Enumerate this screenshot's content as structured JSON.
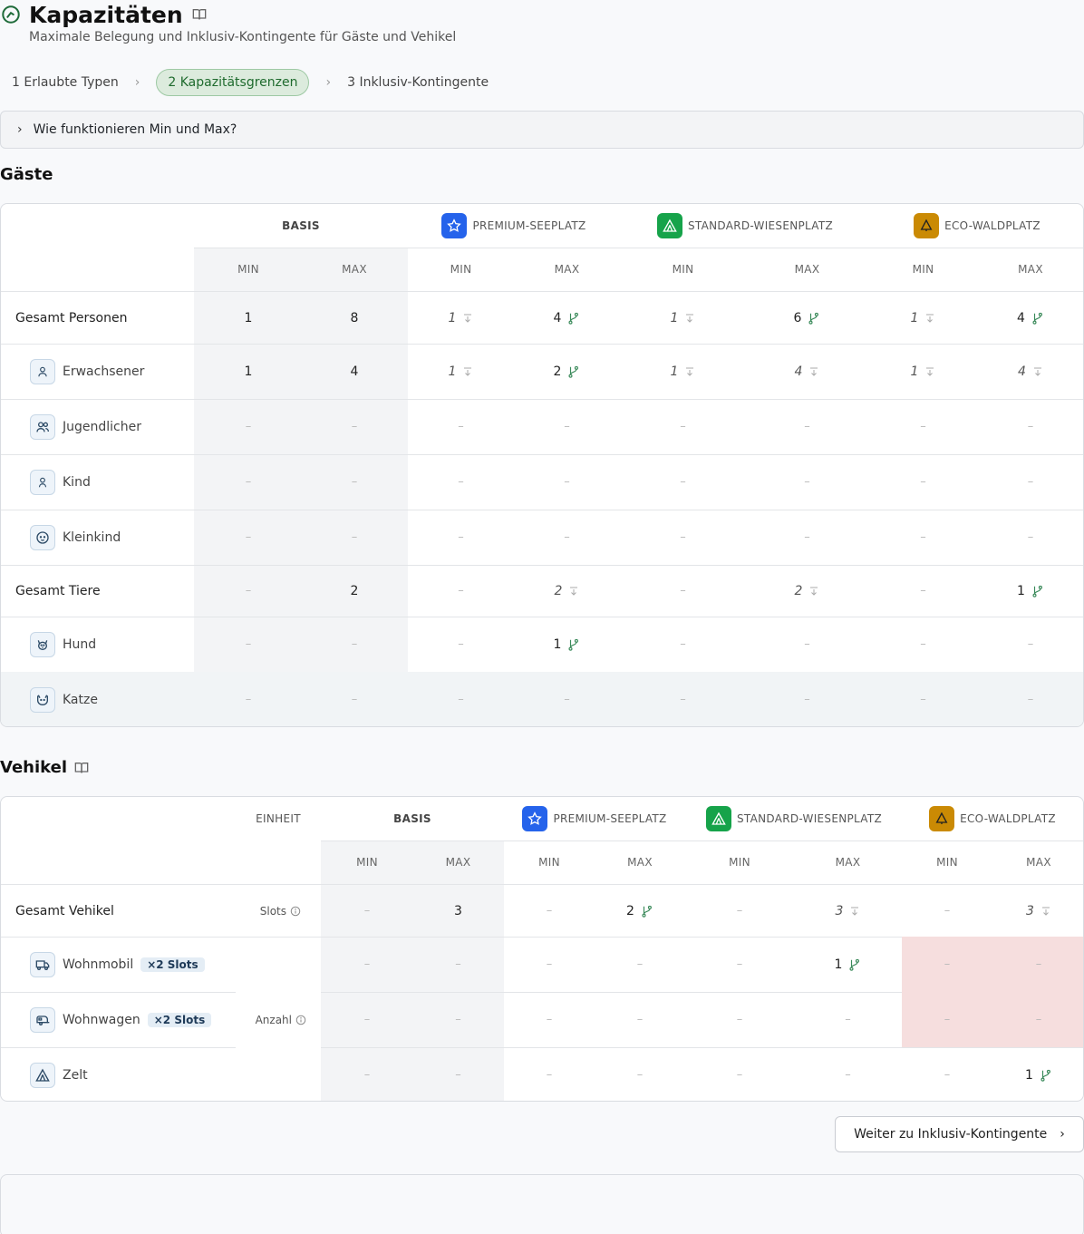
{
  "header": {
    "title": "Kapazitäten",
    "subtitle": "Maximale Belegung und Inklusiv-Kontingente für Gäste und Vehikel"
  },
  "steps": [
    {
      "label": "1  Erlaubte Typen",
      "active": false
    },
    {
      "label": "2  Kapazitätsgrenzen",
      "active": true
    },
    {
      "label": "3  Inklusiv-Kontingente",
      "active": false
    }
  ],
  "accordion": {
    "label": "Wie funktionieren Min und Max?"
  },
  "categories": {
    "basis": "BASIS",
    "premium": {
      "label": "PREMIUM-SEEPLATZ",
      "color": "#2563eb",
      "icon": "star-icon"
    },
    "standard": {
      "label": "STANDARD-WIESENPLATZ",
      "color": "#16a34a",
      "icon": "tent-icon"
    },
    "eco": {
      "label": "ECO-WALDPLATZ",
      "color": "#ca8a04",
      "icon": "tree-icon"
    }
  },
  "sub_headers": {
    "min": "MIN",
    "max": "MAX",
    "unit": "EINHEIT"
  },
  "guests": {
    "title": "Gäste",
    "rows": [
      {
        "label": "Gesamt Personen",
        "total": true,
        "icon": "",
        "cells": [
          [
            "1",
            ""
          ],
          [
            "8",
            ""
          ],
          [
            "1",
            "i"
          ],
          [
            "4",
            "b"
          ],
          [
            "1",
            "i"
          ],
          [
            "6",
            "b"
          ],
          [
            "1",
            "i"
          ],
          [
            "4",
            "b"
          ]
        ]
      },
      {
        "label": "Erwachsener",
        "total": false,
        "icon": "person-icon",
        "cells": [
          [
            "1",
            ""
          ],
          [
            "4",
            ""
          ],
          [
            "1",
            "i"
          ],
          [
            "2",
            "b"
          ],
          [
            "1",
            "i"
          ],
          [
            "4",
            "i"
          ],
          [
            "1",
            "i"
          ],
          [
            "4",
            "i"
          ]
        ]
      },
      {
        "label": "Jugendlicher",
        "total": false,
        "icon": "users-icon",
        "cells": [
          [
            "–",
            ""
          ],
          [
            "–",
            ""
          ],
          [
            "–",
            ""
          ],
          [
            "–",
            ""
          ],
          [
            "–",
            ""
          ],
          [
            "–",
            ""
          ],
          [
            "–",
            ""
          ],
          [
            "–",
            ""
          ]
        ]
      },
      {
        "label": "Kind",
        "total": false,
        "icon": "child-icon",
        "cells": [
          [
            "–",
            ""
          ],
          [
            "–",
            ""
          ],
          [
            "–",
            ""
          ],
          [
            "–",
            ""
          ],
          [
            "–",
            ""
          ],
          [
            "–",
            ""
          ],
          [
            "–",
            ""
          ],
          [
            "–",
            ""
          ]
        ]
      },
      {
        "label": "Kleinkind",
        "total": false,
        "icon": "baby-icon",
        "cells": [
          [
            "–",
            ""
          ],
          [
            "–",
            ""
          ],
          [
            "–",
            ""
          ],
          [
            "–",
            ""
          ],
          [
            "–",
            ""
          ],
          [
            "–",
            ""
          ],
          [
            "–",
            ""
          ],
          [
            "–",
            ""
          ]
        ]
      },
      {
        "label": "Gesamt Tiere",
        "total": true,
        "icon": "",
        "cells": [
          [
            "–",
            ""
          ],
          [
            "2",
            ""
          ],
          [
            "–",
            ""
          ],
          [
            "2",
            "i"
          ],
          [
            "–",
            ""
          ],
          [
            "2",
            "i"
          ],
          [
            "–",
            ""
          ],
          [
            "1",
            "b"
          ]
        ]
      },
      {
        "label": "Hund",
        "total": false,
        "icon": "dog-icon",
        "cells": [
          [
            "–",
            ""
          ],
          [
            "–",
            ""
          ],
          [
            "–",
            ""
          ],
          [
            "1",
            "b"
          ],
          [
            "–",
            ""
          ],
          [
            "–",
            ""
          ],
          [
            "–",
            ""
          ],
          [
            "–",
            ""
          ]
        ]
      },
      {
        "label": "Katze",
        "total": false,
        "icon": "cat-icon",
        "cells": [
          [
            "–",
            ""
          ],
          [
            "–",
            ""
          ],
          [
            "–",
            ""
          ],
          [
            "–",
            ""
          ],
          [
            "–",
            ""
          ],
          [
            "–",
            ""
          ],
          [
            "–",
            ""
          ],
          [
            "–",
            ""
          ]
        ]
      }
    ]
  },
  "vehicles": {
    "title": "Vehikel",
    "unit_slots": "Slots",
    "unit_count": "Anzahl",
    "rows": [
      {
        "label": "Gesamt Vehikel",
        "total": true,
        "icon": "",
        "badge": "",
        "cells": [
          [
            "–",
            ""
          ],
          [
            "3",
            ""
          ],
          [
            "–",
            ""
          ],
          [
            "2",
            "b"
          ],
          [
            "–",
            ""
          ],
          [
            "3",
            "i"
          ],
          [
            "–",
            ""
          ],
          [
            "3",
            "i"
          ]
        ]
      },
      {
        "label": "Wohnmobil",
        "total": false,
        "icon": "camper-icon",
        "badge": "×2 Slots",
        "cells": [
          [
            "–",
            ""
          ],
          [
            "–",
            ""
          ],
          [
            "–",
            ""
          ],
          [
            "–",
            ""
          ],
          [
            "–",
            ""
          ],
          [
            "1",
            "b"
          ],
          [
            "–",
            "r"
          ],
          [
            "–",
            "r"
          ]
        ]
      },
      {
        "label": "Wohnwagen",
        "total": false,
        "icon": "caravan-icon",
        "badge": "×2 Slots",
        "cells": [
          [
            "–",
            ""
          ],
          [
            "–",
            ""
          ],
          [
            "–",
            ""
          ],
          [
            "–",
            ""
          ],
          [
            "–",
            ""
          ],
          [
            "–",
            ""
          ],
          [
            "–",
            "r"
          ],
          [
            "–",
            "r"
          ]
        ]
      },
      {
        "label": "Zelt",
        "total": false,
        "icon": "tent-icon",
        "badge": "",
        "cells": [
          [
            "–",
            ""
          ],
          [
            "–",
            ""
          ],
          [
            "–",
            ""
          ],
          [
            "–",
            ""
          ],
          [
            "–",
            ""
          ],
          [
            "–",
            ""
          ],
          [
            "–",
            ""
          ],
          [
            "1",
            "b"
          ]
        ]
      }
    ]
  },
  "next_button": {
    "label": "Weiter zu Inklusiv-Kontingente"
  }
}
